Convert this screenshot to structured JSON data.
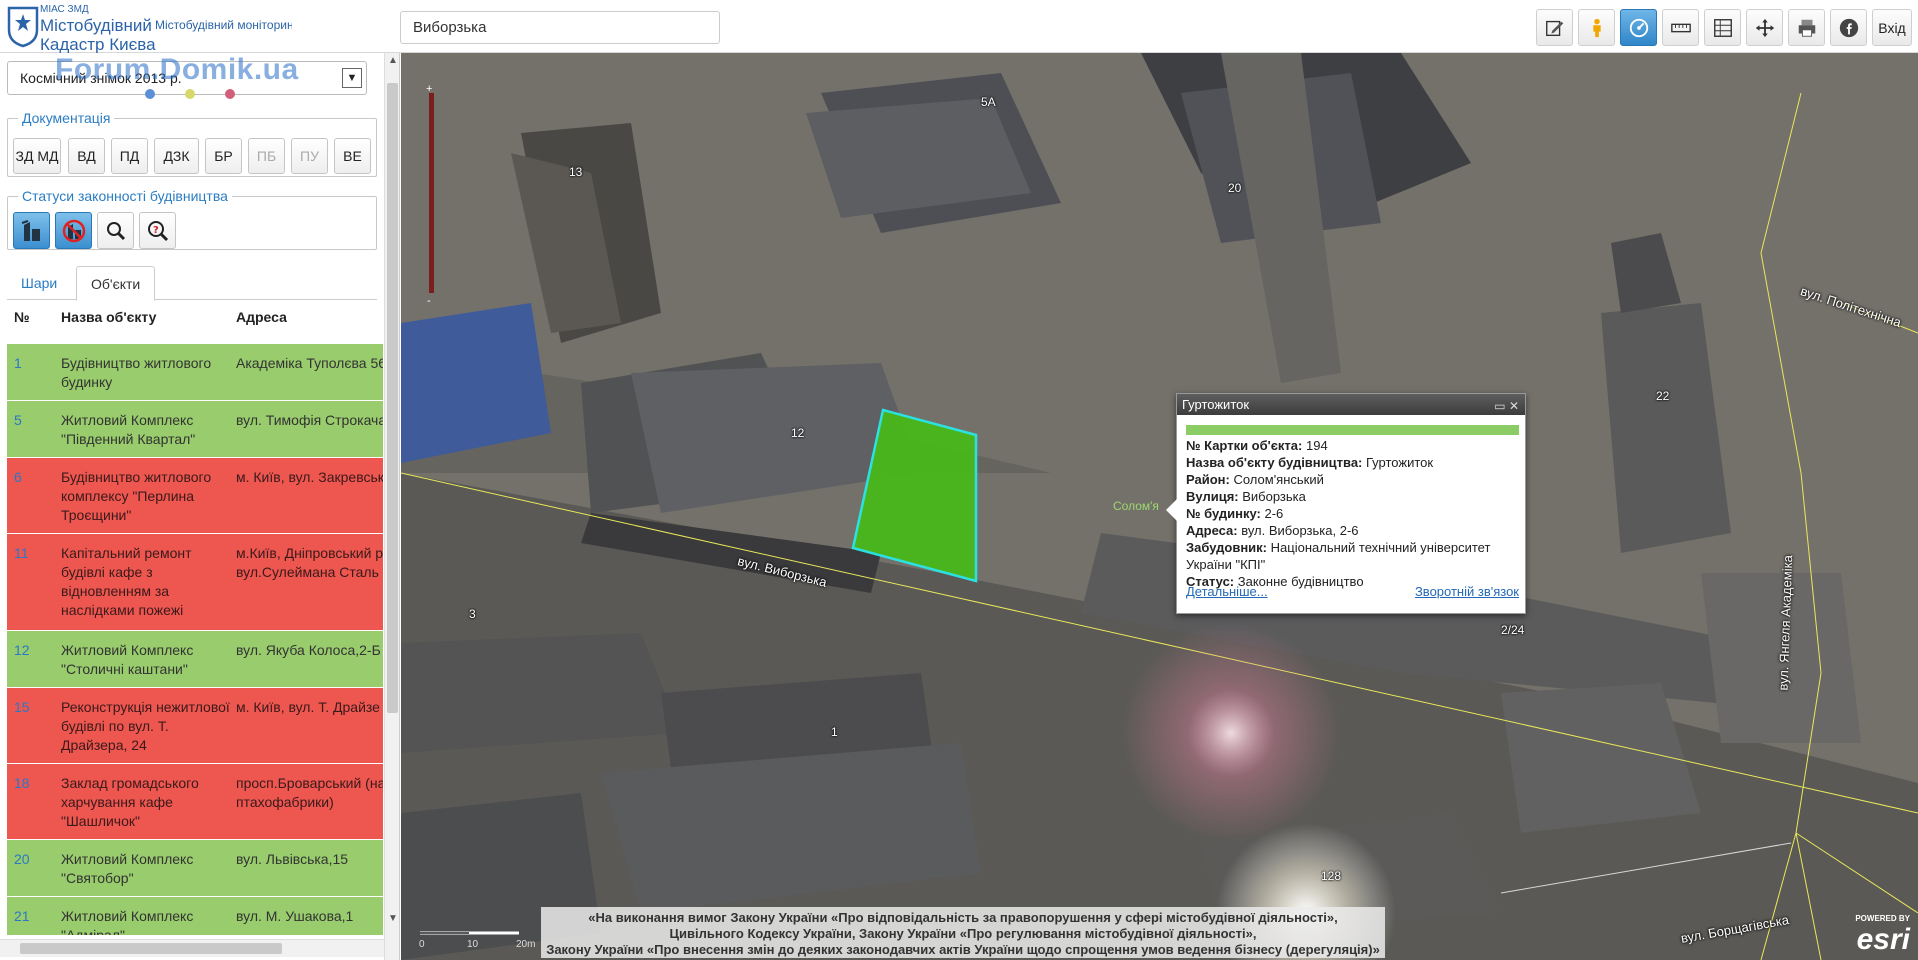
{
  "header": {
    "logo_small": "МІАС ЗМД",
    "logo_line1": "Містобудівний",
    "logo_line2": "Кадастр Києва",
    "subtitle": "Містобудівний моніторинг",
    "search_value": "Виборзька",
    "login_label": "Вхід",
    "toolbar_icons": [
      "edit-icon",
      "street-view-icon",
      "identify-icon",
      "measure-icon",
      "layers-compare-icon",
      "pan-icon",
      "print-icon",
      "facebook-icon"
    ]
  },
  "left_panel": {
    "basemap_selected": "Космічний знімок 2013 р.",
    "watermark": "Forum.Domik.ua",
    "watermark_dot_colors": [
      "#5b8fd6",
      "#d8d86a",
      "#d0607a"
    ],
    "docs_title": "Документація",
    "doc_buttons": [
      {
        "label": "ЗД МД",
        "enabled": true
      },
      {
        "label": "ВД",
        "enabled": true
      },
      {
        "label": "ПД",
        "enabled": true
      },
      {
        "label": "ДЗК",
        "enabled": true
      },
      {
        "label": "БР",
        "enabled": true
      },
      {
        "label": "ПБ",
        "enabled": false
      },
      {
        "label": "ПУ",
        "enabled": false
      },
      {
        "label": "ВЕ",
        "enabled": true
      }
    ],
    "status_title": "Статуси законності будівництва",
    "status_buttons": [
      "legal-construction-icon",
      "illegal-construction-icon",
      "search-icon",
      "help-search-icon"
    ],
    "tabs": [
      "Шари",
      "Об'єкти"
    ],
    "active_tab": 1,
    "columns": [
      "№",
      "Назва об'єкту",
      "Адреса"
    ],
    "rows": [
      {
        "num": "1",
        "name": "Будівництво житлового будинку",
        "address": "Академіка Туполєва 56",
        "status": "green"
      },
      {
        "num": "5",
        "name": "Житловий Комплекс \"Південний Квартал\"",
        "address": "вул. Тимофія Строкача",
        "status": "green"
      },
      {
        "num": "6",
        "name": "Будівництво житлового комплексу \"Перлина Троєщини\"",
        "address": "м. Київ, вул. Закревськ",
        "status": "red"
      },
      {
        "num": "11",
        "name": "Капітальний ремонт будівлі кафе з відновленням за наслідками пожежі",
        "address": "м.Київ, Дніпровський р",
        "address2": "вул.Сулеймана Сталь",
        "status": "red"
      },
      {
        "num": "12",
        "name": "Житловий Комплекс \"Столичні каштани\"",
        "address": "вул. Якуба Колоса,2-Б",
        "status": "green"
      },
      {
        "num": "15",
        "name": "Реконструкція нежитлової будівлі по вул. Т. Драйзера, 24",
        "address": "м. Київ, вул. Т. Драйзе",
        "status": "red"
      },
      {
        "num": "18",
        "name": "Заклад громадського харчування кафе \"Шашличок\"",
        "address": "просп.Броварський (на",
        "address2": "птахофабрики)",
        "status": "red"
      },
      {
        "num": "20",
        "name": "Житловий Комплекс \"Святобор\"",
        "address": "вул. Львівська,15",
        "status": "green"
      },
      {
        "num": "21",
        "name": "Житловий Комплекс \"Адмірал\"",
        "address": "вул. М. Ушакова,1",
        "status": "green"
      }
    ]
  },
  "map": {
    "labels": {
      "n5a": "5А",
      "n13": "13",
      "n20": "20",
      "n12": "12",
      "n22": "22",
      "n3": "3",
      "n1": "1",
      "n224": "2/24",
      "n128": "128",
      "district": "Солом'я"
    },
    "streets": {
      "vyborzka": "вул. Виборзька",
      "politekhnichna": "вул. Політехнічна",
      "yanhelya": "вул. Янгеля Академіка",
      "borshchahivska": "вул. Борщагівська"
    },
    "popup": {
      "title": "Гуртожиток",
      "status_color": "#8ccc64",
      "fields": [
        {
          "label": "№ Картки об'єкта:",
          "value": "194"
        },
        {
          "label": "Назва об'єкту будівництва:",
          "value": "Гуртожиток"
        },
        {
          "label": "Район:",
          "value": "Солом'янський"
        },
        {
          "label": "Вулиця:",
          "value": "Виборзька"
        },
        {
          "label": "№ будинку:",
          "value": "2-6"
        },
        {
          "label": "Адреса:",
          "value": "вул. Виборзька, 2-6"
        },
        {
          "label": "Забудовник:",
          "value": "Національний технічний університет"
        },
        {
          "label": "",
          "value": "України \"КПІ\""
        },
        {
          "label": "Статус:",
          "value": "Законне будівництво"
        }
      ],
      "more_link": "Детальніше...",
      "feedback_link": "Зворотній зв'язок"
    },
    "legal_note": [
      "«На виконання вимог Закону України «Про відповідальність за правопорушення у сфері містобудівної діяльності»,",
      "Цивільного Кодексу України, Закону України «Про регулювання містобудівної діяльності»,",
      "Закону України «Про внесення змін до деяких законодавчих актів України щодо спрощення умов ведення бізнесу (дерегуляція)»"
    ],
    "scale_labels": [
      "0",
      "10",
      "20m"
    ],
    "esri_powered": "POWERED BY",
    "esri_logo": "esri"
  }
}
